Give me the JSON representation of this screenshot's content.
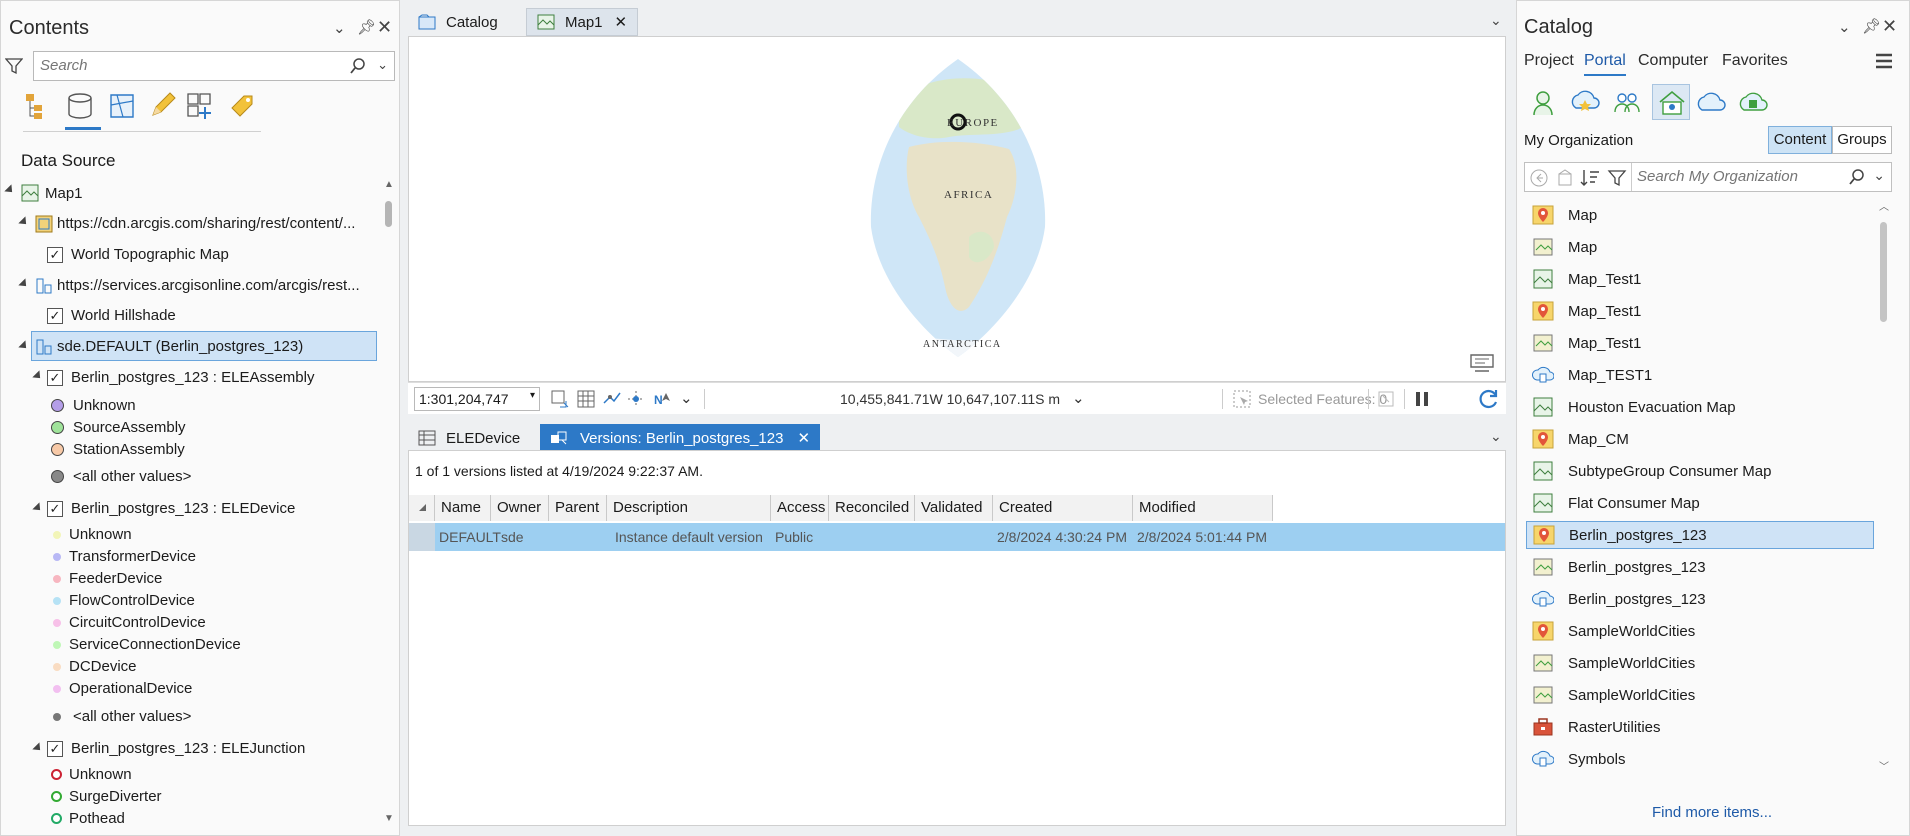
{
  "contents": {
    "title": "Contents",
    "search_placeholder": "Search",
    "section_title": "Data Source",
    "tree": [
      {
        "label": "Map1"
      },
      {
        "label": "https://cdn.arcgis.com/sharing/rest/content/..."
      },
      {
        "label": "World Topographic Map"
      },
      {
        "label": "https://services.arcgisonline.com/arcgis/rest..."
      },
      {
        "label": "World Hillshade"
      },
      {
        "label": "sde.DEFAULT (Berlin_postgres_123)"
      },
      {
        "label": "Berlin_postgres_123 : ELEAssembly"
      },
      {
        "label": "Unknown"
      },
      {
        "label": "SourceAssembly"
      },
      {
        "label": "StationAssembly"
      },
      {
        "label": "<all other values>"
      },
      {
        "label": "Berlin_postgres_123 : ELEDevice"
      },
      {
        "label": "Unknown"
      },
      {
        "label": "TransformerDevice"
      },
      {
        "label": "FeederDevice"
      },
      {
        "label": "FlowControlDevice"
      },
      {
        "label": "CircuitControlDevice"
      },
      {
        "label": "ServiceConnectionDevice"
      },
      {
        "label": "DCDevice"
      },
      {
        "label": "OperationalDevice"
      },
      {
        "label": "<all other values>"
      },
      {
        "label": "Berlin_postgres_123 : ELEJunction"
      },
      {
        "label": "Unknown"
      },
      {
        "label": "SurgeDiverter"
      },
      {
        "label": "Pothead"
      }
    ],
    "colors": {
      "assembly_unknown": "#b49ee8",
      "assembly_source": "#9fe39a",
      "assembly_station": "#f7c9a7",
      "assembly_other": "#888888",
      "device_unknown": "#f2f5b8",
      "device_transformer": "#b8b8f5",
      "device_feeder": "#f7b6c0",
      "device_flow": "#b6e2f5",
      "device_circuit": "#f7c0e8",
      "device_service": "#bff7b6",
      "device_dc": "#f9dcc2",
      "device_operational": "#f2bff0",
      "device_other": "#777777"
    }
  },
  "center": {
    "tabs": [
      {
        "label": "Catalog"
      },
      {
        "label": "Map1"
      }
    ],
    "map_labels": {
      "europe": "EUROPE",
      "africa": "AFRICA",
      "antarctica": "ANTARCTICA"
    },
    "scale": "1:301,204,747",
    "coords": "10,455,841.71W 10,647,107.11S m",
    "selected_features": "Selected Features: 0",
    "bottom_tabs": [
      {
        "label": "ELEDevice"
      },
      {
        "label": "Versions: Berlin_postgres_123"
      }
    ],
    "versions_info": "1 of 1 versions listed at 4/19/2024 9:22:37 AM.",
    "columns": [
      "Name",
      "Owner",
      "Parent",
      "Description",
      "Access",
      "Reconciled",
      "Validated",
      "Created",
      "Modified"
    ],
    "rows": [
      {
        "name": "DEFAULT",
        "owner": "sde",
        "parent": "",
        "description": "Instance default version",
        "access": "Public",
        "reconciled": "",
        "validated": "",
        "created": "2/8/2024 4:30:24 PM",
        "modified": "2/8/2024 5:01:44 PM"
      }
    ]
  },
  "catalog": {
    "title": "Catalog",
    "tabs": [
      {
        "label": "Project"
      },
      {
        "label": "Portal"
      },
      {
        "label": "Computer"
      },
      {
        "label": "Favorites"
      }
    ],
    "org_label": "My Organization",
    "content_btn": "Content",
    "groups_btn": "Groups",
    "search_placeholder": "Search My Organization",
    "items": [
      {
        "label": "Map",
        "icon": "map-pin-icon"
      },
      {
        "label": "Map",
        "icon": "web-map-icon"
      },
      {
        "label": "Map_Test1",
        "icon": "map-project-icon"
      },
      {
        "label": "Map_Test1",
        "icon": "map-pin-icon"
      },
      {
        "label": "Map_Test1",
        "icon": "web-map-icon"
      },
      {
        "label": "Map_TEST1",
        "icon": "service-icon"
      },
      {
        "label": "Houston Evacuation Map",
        "icon": "map-project-icon"
      },
      {
        "label": "Map_CM",
        "icon": "map-pin-icon"
      },
      {
        "label": "SubtypeGroup Consumer Map",
        "icon": "map-project-icon"
      },
      {
        "label": "Flat Consumer Map",
        "icon": "map-project-icon"
      },
      {
        "label": "Berlin_postgres_123",
        "icon": "map-pin-icon"
      },
      {
        "label": "Berlin_postgres_123",
        "icon": "web-map-icon"
      },
      {
        "label": "Berlin_postgres_123",
        "icon": "service-icon"
      },
      {
        "label": "SampleWorldCities",
        "icon": "map-pin-icon"
      },
      {
        "label": "SampleWorldCities",
        "icon": "web-map-icon"
      },
      {
        "label": "SampleWorldCities",
        "icon": "web-map-icon"
      },
      {
        "label": "RasterUtilities",
        "icon": "toolbox-icon"
      },
      {
        "label": "Symbols",
        "icon": "service-icon"
      }
    ],
    "find_more": "Find more items..."
  }
}
